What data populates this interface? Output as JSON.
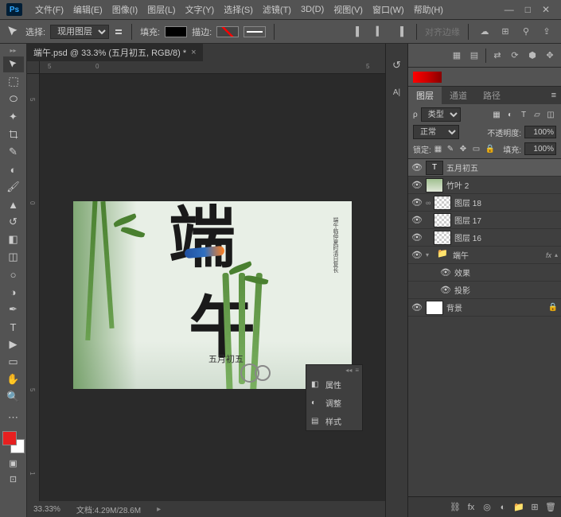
{
  "app": {
    "logo": "Ps"
  },
  "menu": {
    "file": "文件(F)",
    "edit": "编辑(E)",
    "image": "图像(I)",
    "layer": "图层(L)",
    "type": "文字(Y)",
    "select": "选择(S)",
    "filter": "滤镜(T)",
    "threed": "3D(D)",
    "view": "视图(V)",
    "window": "窗口(W)",
    "help": "帮助(H)"
  },
  "options": {
    "select_label": "选择:",
    "select_value": "现用图层",
    "fill_label": "填充:",
    "stroke_label": "描边:"
  },
  "options_right": {
    "snap_label": "对齐边缘"
  },
  "document": {
    "tab_title": "端午.psd @ 33.3% (五月初五, RGB/8) *",
    "zoom": "33.33%",
    "file_info": "文档:4.29M/28.6M"
  },
  "canvas_art": {
    "main_char1": "端",
    "main_char2": "午",
    "sub_text": "五月初五",
    "vertical_text": "端午临仲夏时清日复长"
  },
  "props_panel": {
    "properties": "属性",
    "adjust": "调整",
    "styles": "样式"
  },
  "layers_panel": {
    "tab_layers": "图层",
    "tab_channels": "通道",
    "tab_paths": "路径",
    "filter_type": "类型",
    "blend_mode": "正常",
    "opacity_label": "不透明度:",
    "opacity_value": "100%",
    "lock_label": "锁定:",
    "fill_label": "填充:",
    "fill_value": "100%"
  },
  "layers": [
    {
      "name": "五月初五",
      "type": "text",
      "selected": true
    },
    {
      "name": "竹叶 2",
      "type": "bamboo"
    },
    {
      "name": "图层 18",
      "type": "checker",
      "linked": true
    },
    {
      "name": "图层 17",
      "type": "checker"
    },
    {
      "name": "图层 16",
      "type": "checker"
    },
    {
      "name": "端午",
      "type": "folder",
      "has_fx": true,
      "expanded": true
    },
    {
      "name": "效果",
      "type": "effect",
      "indent": 2
    },
    {
      "name": "投影",
      "type": "effect",
      "indent": 2
    },
    {
      "name": "背景",
      "type": "white",
      "locked": true
    }
  ],
  "ruler_h": [
    "5",
    "0",
    "5"
  ],
  "ruler_v": [
    "5",
    "0",
    "5",
    "1"
  ]
}
